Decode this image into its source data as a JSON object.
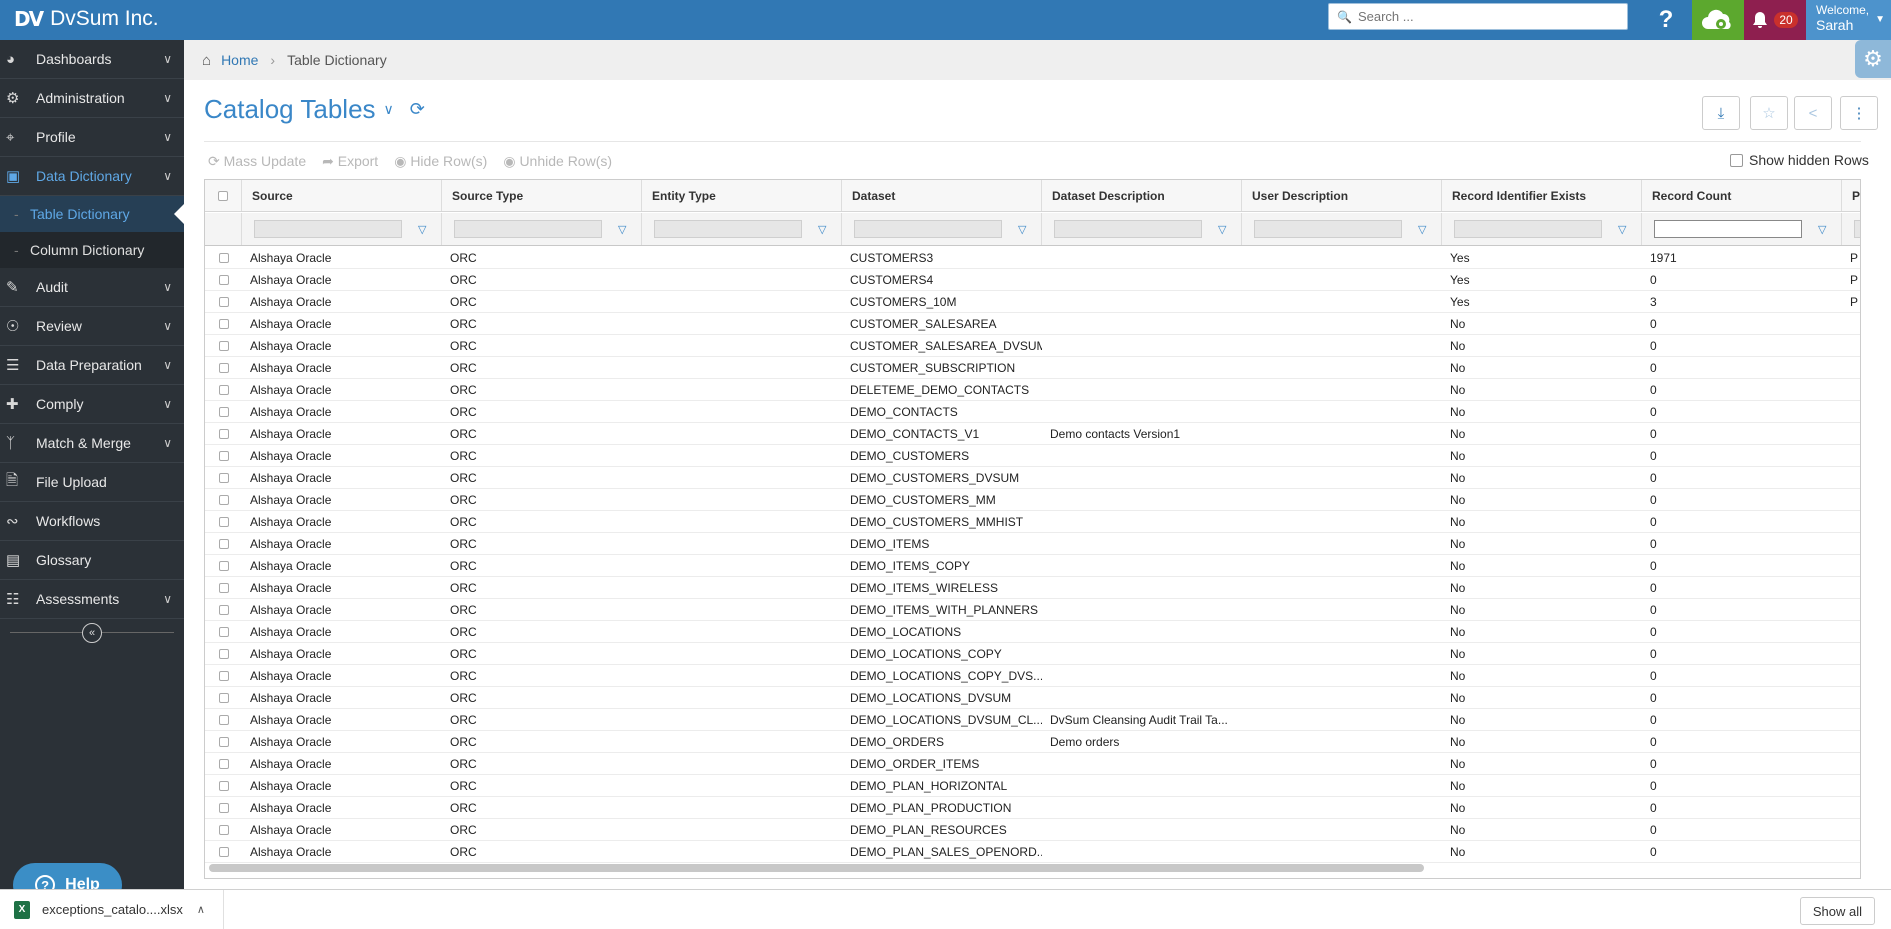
{
  "app": {
    "brand": "DvSum Inc.",
    "brand_mark": "DV",
    "search_placeholder": "Search ...",
    "notifications_count": "20",
    "welcome": "Welcome,",
    "user": "Sarah",
    "colors": {
      "topbar": "#3178b4",
      "cloud": "#5ca82e",
      "bell": "#8e1f4f",
      "user": "#4d93cc",
      "sidebar": "#2b3137",
      "accent": "#3a87c8"
    }
  },
  "sidebar": {
    "items": [
      {
        "label": "Dashboards",
        "icon": "dashboard-icon",
        "chev": true
      },
      {
        "label": "Administration",
        "icon": "cogs-icon",
        "chev": true
      },
      {
        "label": "Profile",
        "icon": "crosshair-icon",
        "chev": true
      },
      {
        "label": "Data Dictionary",
        "icon": "dictionary-icon",
        "chev": true
      },
      {
        "label": "Audit",
        "icon": "edit-icon",
        "chev": true
      },
      {
        "label": "Review",
        "icon": "review-icon",
        "chev": true
      },
      {
        "label": "Data Preparation",
        "icon": "database-icon",
        "chev": true
      },
      {
        "label": "Comply",
        "icon": "comply-icon",
        "chev": true
      },
      {
        "label": "Match & Merge",
        "icon": "merge-icon",
        "chev": true
      },
      {
        "label": "File Upload",
        "icon": "file-icon",
        "chev": false
      },
      {
        "label": "Workflows",
        "icon": "workflow-icon",
        "chev": false
      },
      {
        "label": "Glossary",
        "icon": "glossary-icon",
        "chev": false
      },
      {
        "label": "Assessments",
        "icon": "assessment-icon",
        "chev": true
      }
    ],
    "sub_items": [
      "Table Dictionary",
      "Column Dictionary"
    ],
    "help": "Help"
  },
  "breadcrumb": {
    "home": "Home",
    "current": "Table Dictionary"
  },
  "page": {
    "title": "Catalog Tables"
  },
  "toolbar": {
    "mass_update": "Mass Update",
    "export": "Export",
    "hide_rows": "Hide Row(s)",
    "unhide_rows": "Unhide Row(s)",
    "show_hidden": "Show hidden Rows"
  },
  "grid": {
    "columns": [
      "Source",
      "Source Type",
      "Entity Type",
      "Dataset",
      "Dataset Description",
      "User Description",
      "Record Identifier Exists",
      "Record Count",
      "Pro"
    ],
    "rows": [
      [
        "Alshaya Oracle",
        "ORC",
        "",
        "CUSTOMERS3",
        "",
        "",
        "Yes",
        "1971",
        "P"
      ],
      [
        "Alshaya Oracle",
        "ORC",
        "",
        "CUSTOMERS4",
        "",
        "",
        "Yes",
        "0",
        "P"
      ],
      [
        "Alshaya Oracle",
        "ORC",
        "",
        "CUSTOMERS_10M",
        "",
        "",
        "Yes",
        "3",
        "P"
      ],
      [
        "Alshaya Oracle",
        "ORC",
        "",
        "CUSTOMER_SALESAREA",
        "",
        "",
        "No",
        "0",
        ""
      ],
      [
        "Alshaya Oracle",
        "ORC",
        "",
        "CUSTOMER_SALESAREA_DVSUM",
        "",
        "",
        "No",
        "0",
        ""
      ],
      [
        "Alshaya Oracle",
        "ORC",
        "",
        "CUSTOMER_SUBSCRIPTION",
        "",
        "",
        "No",
        "0",
        ""
      ],
      [
        "Alshaya Oracle",
        "ORC",
        "",
        "DELETEME_DEMO_CONTACTS",
        "",
        "",
        "No",
        "0",
        ""
      ],
      [
        "Alshaya Oracle",
        "ORC",
        "",
        "DEMO_CONTACTS",
        "",
        "",
        "No",
        "0",
        ""
      ],
      [
        "Alshaya Oracle",
        "ORC",
        "",
        "DEMO_CONTACTS_V1",
        "Demo contacts Version1",
        "",
        "No",
        "0",
        ""
      ],
      [
        "Alshaya Oracle",
        "ORC",
        "",
        "DEMO_CUSTOMERS",
        "",
        "",
        "No",
        "0",
        ""
      ],
      [
        "Alshaya Oracle",
        "ORC",
        "",
        "DEMO_CUSTOMERS_DVSUM",
        "",
        "",
        "No",
        "0",
        ""
      ],
      [
        "Alshaya Oracle",
        "ORC",
        "",
        "DEMO_CUSTOMERS_MM",
        "",
        "",
        "No",
        "0",
        ""
      ],
      [
        "Alshaya Oracle",
        "ORC",
        "",
        "DEMO_CUSTOMERS_MMHIST",
        "",
        "",
        "No",
        "0",
        ""
      ],
      [
        "Alshaya Oracle",
        "ORC",
        "",
        "DEMO_ITEMS",
        "",
        "",
        "No",
        "0",
        ""
      ],
      [
        "Alshaya Oracle",
        "ORC",
        "",
        "DEMO_ITEMS_COPY",
        "",
        "",
        "No",
        "0",
        ""
      ],
      [
        "Alshaya Oracle",
        "ORC",
        "",
        "DEMO_ITEMS_WIRELESS",
        "",
        "",
        "No",
        "0",
        ""
      ],
      [
        "Alshaya Oracle",
        "ORC",
        "",
        "DEMO_ITEMS_WITH_PLANNERS",
        "",
        "",
        "No",
        "0",
        ""
      ],
      [
        "Alshaya Oracle",
        "ORC",
        "",
        "DEMO_LOCATIONS",
        "",
        "",
        "No",
        "0",
        ""
      ],
      [
        "Alshaya Oracle",
        "ORC",
        "",
        "DEMO_LOCATIONS_COPY",
        "",
        "",
        "No",
        "0",
        ""
      ],
      [
        "Alshaya Oracle",
        "ORC",
        "",
        "DEMO_LOCATIONS_COPY_DVS...",
        "",
        "",
        "No",
        "0",
        ""
      ],
      [
        "Alshaya Oracle",
        "ORC",
        "",
        "DEMO_LOCATIONS_DVSUM",
        "",
        "",
        "No",
        "0",
        ""
      ],
      [
        "Alshaya Oracle",
        "ORC",
        "",
        "DEMO_LOCATIONS_DVSUM_CL...",
        "DvSum Cleansing Audit Trail Ta...",
        "",
        "No",
        "0",
        ""
      ],
      [
        "Alshaya Oracle",
        "ORC",
        "",
        "DEMO_ORDERS",
        "Demo orders",
        "",
        "No",
        "0",
        ""
      ],
      [
        "Alshaya Oracle",
        "ORC",
        "",
        "DEMO_ORDER_ITEMS",
        "",
        "",
        "No",
        "0",
        ""
      ],
      [
        "Alshaya Oracle",
        "ORC",
        "",
        "DEMO_PLAN_HORIZONTAL",
        "",
        "",
        "No",
        "0",
        ""
      ],
      [
        "Alshaya Oracle",
        "ORC",
        "",
        "DEMO_PLAN_PRODUCTION",
        "",
        "",
        "No",
        "0",
        ""
      ],
      [
        "Alshaya Oracle",
        "ORC",
        "",
        "DEMO_PLAN_RESOURCES",
        "",
        "",
        "No",
        "0",
        ""
      ],
      [
        "Alshaya Oracle",
        "ORC",
        "",
        "DEMO_PLAN_SALES_OPENORD...",
        "",
        "",
        "No",
        "0",
        ""
      ]
    ]
  },
  "downloads": {
    "file": "exceptions_catalo....xlsx",
    "show_all": "Show all"
  }
}
